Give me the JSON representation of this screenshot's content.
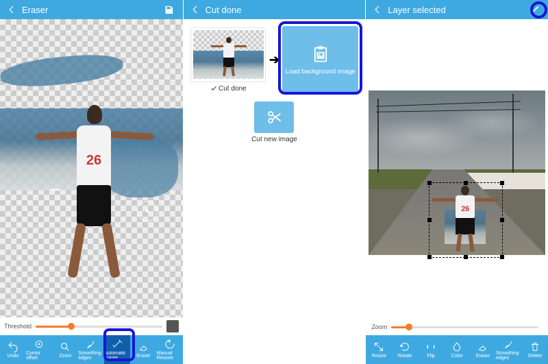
{
  "panel1": {
    "title": "Eraser",
    "jersey_number": "26",
    "threshold_label": "Threshold",
    "threshold_percent": 28,
    "tools": [
      {
        "label": "Undo",
        "icon": "undo"
      },
      {
        "label": "Cursor offset",
        "icon": "target"
      },
      {
        "label": "Zoom",
        "icon": "zoom"
      },
      {
        "label": "Smoothing edges",
        "icon": "feather"
      },
      {
        "label": "Automatic eraser",
        "icon": "wand",
        "active": true
      },
      {
        "label": "Eraser",
        "icon": "eraser"
      },
      {
        "label": "Manual Restore",
        "icon": "restore"
      }
    ]
  },
  "panel2": {
    "title": "Cut done",
    "cut_done_label": "Cut done",
    "load_bg_label": "Load background image",
    "cut_new_label": "Cut new image"
  },
  "panel3": {
    "title": "Layer selected",
    "zoom_label": "Zoom",
    "zoom_percent": 12,
    "tools": [
      {
        "label": "Resize",
        "icon": "resize"
      },
      {
        "label": "Rotate",
        "icon": "rotate"
      },
      {
        "label": "Flip",
        "icon": "flip"
      },
      {
        "label": "Color",
        "icon": "color"
      },
      {
        "label": "Eraser",
        "icon": "eraser"
      },
      {
        "label": "Smoothing edges",
        "icon": "feather"
      },
      {
        "label": "Delete",
        "icon": "trash"
      }
    ]
  },
  "colors": {
    "accent": "#3ea9e0",
    "highlight": "#1616d8",
    "slider": "#f47b2a"
  }
}
